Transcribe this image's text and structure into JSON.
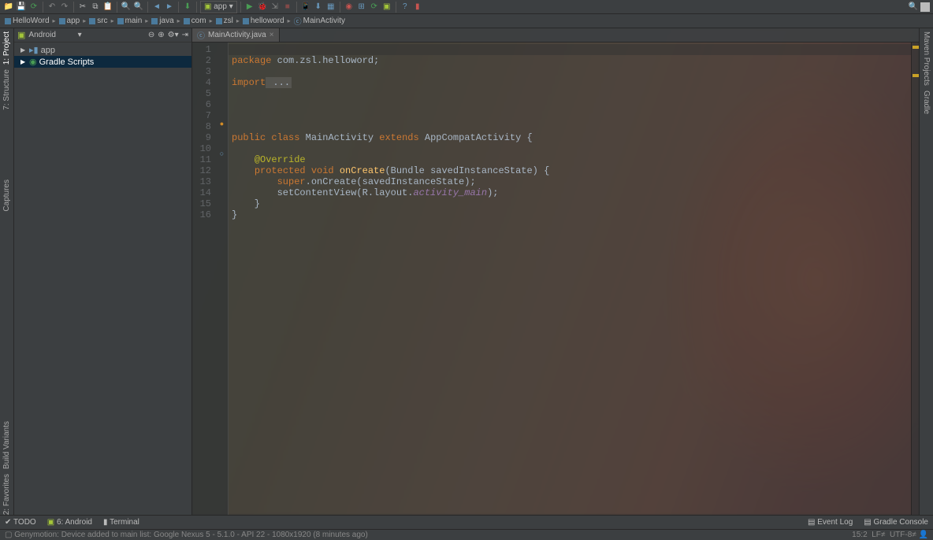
{
  "toolbar": {
    "app_combo": "app"
  },
  "breadcrumb": {
    "items": [
      "HelloWord",
      "app",
      "src",
      "main",
      "java",
      "com",
      "zsl",
      "helloword",
      "MainActivity"
    ]
  },
  "project": {
    "combo": "Android",
    "items": [
      {
        "label": "app",
        "icon": "module",
        "indent": 0,
        "selected": false
      },
      {
        "label": "Gradle Scripts",
        "icon": "gradle",
        "indent": 0,
        "selected": true
      }
    ]
  },
  "tabs": {
    "active": "MainActivity.java"
  },
  "left_gutter": {
    "project": "1: Project",
    "structure": "7: Structure",
    "captures": "Captures",
    "build": "Build Variants",
    "favorites": "2: Favorites"
  },
  "right_gutter": {
    "maven": "Maven Projects",
    "gradle": "Gradle"
  },
  "code": {
    "lines": [
      "1",
      "2",
      "3",
      "4",
      "5",
      "6",
      "7",
      "8",
      "9",
      "10",
      "11",
      "12",
      "13",
      "14",
      "15",
      "16"
    ],
    "pkg": "package",
    "pkg_val": " com.zsl.helloword;",
    "imp": "import",
    "imp_fold": " ...",
    "pub": "public",
    "cls": "class",
    "name": " MainActivity ",
    "ext": "extends",
    "parent": " AppCompatActivity {",
    "over": "@Override",
    "prot": "protected",
    "void": "void",
    "oncreate": "onCreate",
    "params": "(Bundle savedInstanceState) {",
    "super": "super",
    "supertail": ".onCreate(savedInstanceState);",
    "setcv": "setContentView(R.layout.",
    "actm": "activity_main",
    "setcv_tail": ");",
    "close1": "    }",
    "close0": "}"
  },
  "bottom": {
    "todo": "TODO",
    "android": "6: Android",
    "terminal": "Terminal",
    "eventlog": "Event Log",
    "gradleconsole": "Gradle Console"
  },
  "status": {
    "msg": "Genymotion: Device added to main list: Google Nexus 5 - 5.1.0 - API 22 - 1080x1920 (8 minutes ago)",
    "pos": "15:2",
    "lf": "LF≠",
    "enc": "UTF-8≠"
  }
}
